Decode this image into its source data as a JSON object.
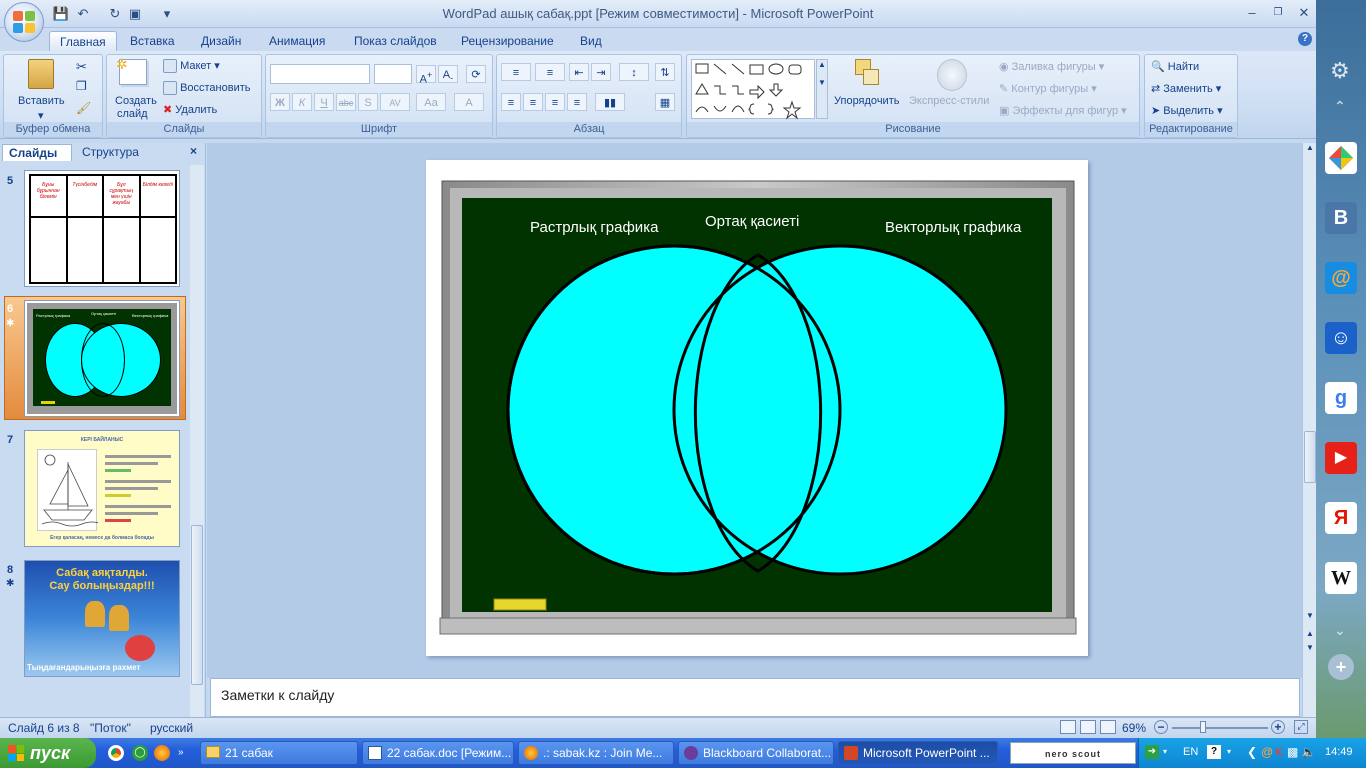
{
  "window": {
    "title": "WordPad ашық сабақ.ppt [Режим совместимости] - Microsoft PowerPoint"
  },
  "tabs": [
    "Главная",
    "Вставка",
    "Дизайн",
    "Анимация",
    "Показ слайдов",
    "Рецензирование",
    "Вид"
  ],
  "ribbon": {
    "clipboard": {
      "label": "Буфер обмена",
      "paste": "Вставить"
    },
    "slides": {
      "label": "Слайды",
      "new_slide": "Создать",
      "new_slide2": "слайд",
      "layout": "Макет",
      "reset": "Восстановить",
      "delete": "Удалить"
    },
    "font": {
      "label": "Шрифт"
    },
    "paragraph": {
      "label": "Абзац"
    },
    "drawing": {
      "label": "Рисование",
      "arrange": "Упорядочить",
      "quick_styles": "Экспресс-стили",
      "fill": "Заливка фигуры",
      "outline": "Контур фигуры",
      "effects": "Эффекты для фигур"
    },
    "editing": {
      "label": "Редактирование",
      "find": "Найти",
      "replace": "Заменить",
      "select": "Выделить"
    }
  },
  "panel": {
    "tab_slides": "Слайды",
    "tab_outline": "Структура",
    "slide_numbers": [
      "5",
      "6",
      "7",
      "8"
    ],
    "thumb5_headers": [
      "Бұны бұрыннан білемін",
      "Түсінбедім",
      "Бұл сұрақтың мен үшін жауабы",
      "Білдім келеді"
    ],
    "thumb6_labels": [
      "Растрлық графика",
      "Ортақ қасиеті",
      "Векторлық графика"
    ],
    "thumb7_title": "КЕРІ БАЙЛАНЫС",
    "thumb7_footer": "Егер қаласаң, немесе да болмаса болады",
    "thumb8_title1": "Сабақ аяқталды.",
    "thumb8_title2": "Сау болыңыздар!!!",
    "thumb8_footer": "Тыңдағандарыңызға рахмет"
  },
  "slide": {
    "label_left": "Растрлық графика",
    "label_center": "Ортақ қасиеті",
    "label_right": "Векторлық графика",
    "circle_fill": "#00ffff",
    "board_color": "#003300"
  },
  "notes": {
    "placeholder": "Заметки к слайду"
  },
  "status": {
    "slide_info": "Слайд 6 из 8",
    "theme": "\"Поток\"",
    "language": "русский",
    "zoom": "69%"
  },
  "taskbar": {
    "start": "пуск",
    "tasks": [
      "21 сабак",
      "22 сабак.doc [Режим...",
      ".: sabak.kz : Join Me...",
      "Blackboard Collaborat...",
      "Microsoft PowerPoint ..."
    ],
    "nero": "nero scout",
    "lang": "EN",
    "clock": "14:49"
  },
  "sidebar_icons": [
    "vk-icon",
    "mail-icon",
    "odnoklassniki-icon",
    "google-icon",
    "youtube-icon",
    "yandex-icon",
    "wikipedia-icon"
  ]
}
